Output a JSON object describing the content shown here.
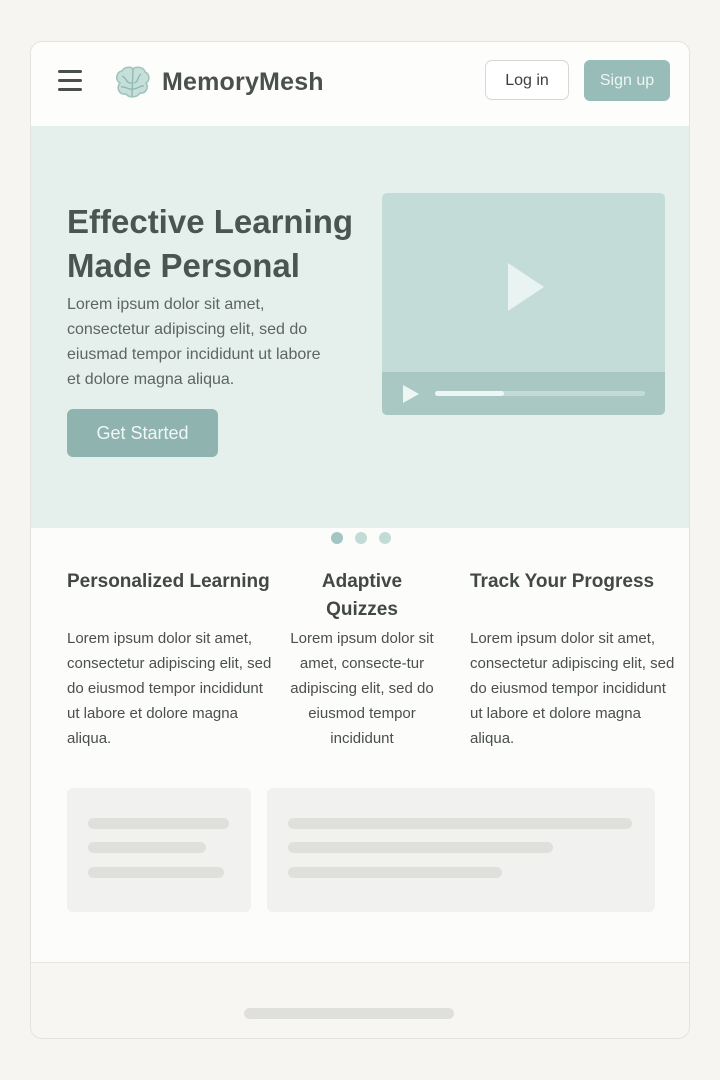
{
  "header": {
    "brand": "MemoryMesh",
    "login_label": "Log in",
    "signup_label": "Sign up"
  },
  "hero": {
    "title": "Effective Learning Made Personal",
    "text": "Lorem ipsum dolor sit amet, consectetur adipiscing elit, sed do eiusmad tempor incididunt ut labore et dolore magna aliqua.",
    "cta_label": "Get Started",
    "video_progress": 0.33,
    "carousel_count": 3,
    "carousel_active": 0
  },
  "features": [
    {
      "title": "Personalized Learning",
      "text": "Lorem ipsum dolor sit amet, consectetur adipiscing elit, sed do eiusmod tempor incididunt ut labore et dolore magna aliqua."
    },
    {
      "title": "Adaptive Quizzes",
      "text": "Lorem ipsum dolor sit amet, consecte-tur adipiscing elit, sed do eiusmod tempor incididunt"
    },
    {
      "title": "Track Your Progress",
      "text": "Lorem ipsum dolor sit amet, consectetur adipiscing elit, sed do eiusmod tempor incididunt ut labore et dolore magna aliqua."
    }
  ],
  "colors": {
    "accent": "#98bcb7",
    "hero_bg": "#e5f0ed",
    "video_bg": "#c4dcd8",
    "dot_active": "#a4c6c2",
    "dot_inactive": "#c3dbd7"
  },
  "icons": [
    "menu-icon",
    "brain-logo-icon",
    "play-icon"
  ]
}
